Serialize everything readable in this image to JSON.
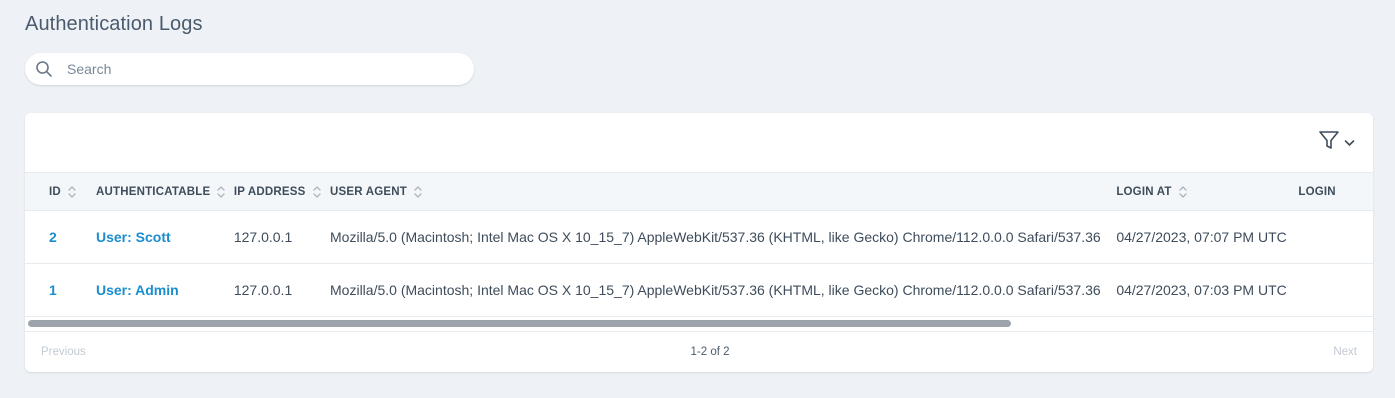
{
  "page": {
    "title": "Authentication Logs"
  },
  "search": {
    "placeholder": "Search",
    "value": ""
  },
  "table": {
    "columns": [
      {
        "label": "ID"
      },
      {
        "label": "AUTHENTICATABLE"
      },
      {
        "label": "IP ADDRESS"
      },
      {
        "label": "USER AGENT"
      },
      {
        "label": "LOGIN AT"
      },
      {
        "label": "LOGIN"
      }
    ],
    "rows": [
      {
        "id": "2",
        "authenticatable": "User: Scott",
        "ip": "127.0.0.1",
        "user_agent": "Mozilla/5.0 (Macintosh; Intel Mac OS X 10_15_7) AppleWebKit/537.36 (KHTML, like Gecko) Chrome/112.0.0.0 Safari/537.36",
        "login_at": "04/27/2023, 07:07 PM UTC"
      },
      {
        "id": "1",
        "authenticatable": "User: Admin",
        "ip": "127.0.0.1",
        "user_agent": "Mozilla/5.0 (Macintosh; Intel Mac OS X 10_15_7) AppleWebKit/537.36 (KHTML, like Gecko) Chrome/112.0.0.0 Safari/537.36",
        "login_at": "04/27/2023, 07:03 PM UTC"
      }
    ]
  },
  "pagination": {
    "previous": "Previous",
    "range": "1-2 of 2",
    "next": "Next"
  },
  "colors": {
    "background": "#eef2f6",
    "link": "#1a8ecf",
    "text": "#3e4c5b",
    "disabled": "#c3cad2"
  },
  "icons": {
    "search": "search-icon",
    "filter": "filter-icon",
    "chevron": "chevron-down-icon",
    "sort": "sort-icon"
  }
}
